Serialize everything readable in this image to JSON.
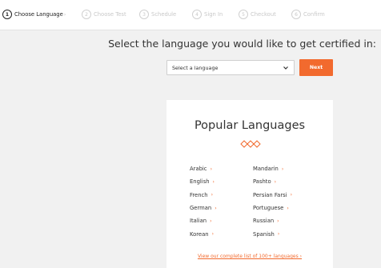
{
  "steps": [
    {
      "num": "1",
      "label": "Choose Language",
      "chevron": "›"
    },
    {
      "num": "2",
      "label": "Choose Test"
    },
    {
      "num": "3",
      "label": "Schedule"
    },
    {
      "num": "4",
      "label": "Sign In"
    },
    {
      "num": "5",
      "label": "Checkout"
    },
    {
      "num": "6",
      "label": "Confirm"
    }
  ],
  "heading": "Select the language you would like to get certified in:",
  "select": {
    "value": "Select a language"
  },
  "next_label": "Next",
  "popular": {
    "title": "Popular Languages",
    "arrow": "›",
    "left": [
      "Arabic",
      "English",
      "French",
      "German",
      "Italian",
      "Korean"
    ],
    "right": [
      "Mandarin",
      "Pashto",
      "Persian Farsi",
      "Portuguese",
      "Russian",
      "Spanish"
    ],
    "view_all": "View our complete list of 100+ languages ›"
  },
  "colors": {
    "accent": "#f26a2e",
    "active_step": "#222222",
    "inactive_step": "#c8c8c8"
  },
  "icons": {
    "dropdown": "chevron-down-icon",
    "ornament": "diamond-ornament-icon"
  }
}
